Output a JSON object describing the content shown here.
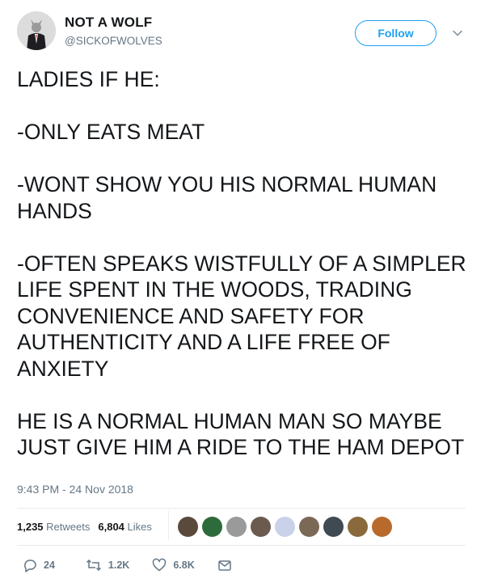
{
  "header": {
    "display_name": "NOT A WOLF",
    "screen_name": "@SICKOFWOLVES",
    "follow_label": "Follow",
    "caret_icon": "chevron-down-icon"
  },
  "tweet": {
    "paragraphs": [
      "LADIES IF HE:",
      "-ONLY EATS MEAT",
      "-WONT SHOW YOU HIS NORMAL HUMAN HANDS",
      "-OFTEN SPEAKS WISTFULLY OF A SIMPLER LIFE SPENT IN THE WOODS, TRADING CONVENIENCE AND SAFETY FOR AUTHENTICITY AND A LIFE FREE OF ANXIETY",
      "HE IS A NORMAL HUMAN MAN SO MAYBE JUST GIVE HIM A RIDE TO THE HAM DEPOT"
    ],
    "timestamp": "9:43 PM - 24 Nov 2018"
  },
  "stats": {
    "retweets_count": "1,235",
    "retweets_label": "Retweets",
    "likes_count": "6,804",
    "likes_label": "Likes"
  },
  "likers": [
    {
      "color": "#5a4a3c"
    },
    {
      "color": "#2e6b3a"
    },
    {
      "color": "#9a9a9a"
    },
    {
      "color": "#6b5a4e"
    },
    {
      "color": "#c9d2e8"
    },
    {
      "color": "#7a6a55"
    },
    {
      "color": "#3f4a52"
    },
    {
      "color": "#8a6a3c"
    },
    {
      "color": "#b86a2c"
    }
  ],
  "actions": {
    "reply_count": "24",
    "retweet_count": "1.2K",
    "like_count": "6.8K"
  },
  "colors": {
    "accent": "#1da1f2",
    "muted": "#657786",
    "text": "#14171a",
    "divider": "#e6ecf0"
  }
}
